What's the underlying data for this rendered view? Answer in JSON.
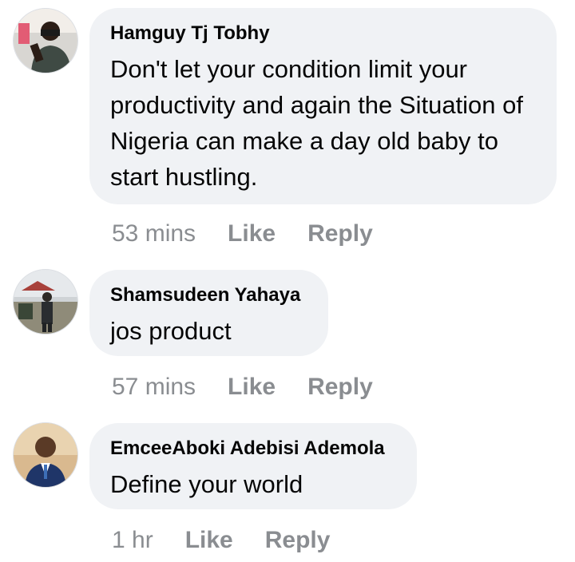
{
  "comments": [
    {
      "author": "Hamguy Tj Tobhy",
      "text": "Don't let your condition limit your productivity and again the Situation of Nigeria can make a day old baby to start hustling.",
      "time": "53 mins",
      "like_label": "Like",
      "reply_label": "Reply"
    },
    {
      "author": "Shamsudeen Yahaya",
      "text": "jos product",
      "time": "57 mins",
      "like_label": "Like",
      "reply_label": "Reply"
    },
    {
      "author": "EmceeAboki Adebisi Ademola",
      "text": "Define your world",
      "time": "1 hr",
      "like_label": "Like",
      "reply_label": "Reply"
    }
  ],
  "colors": {
    "bubble_bg": "#f0f2f5",
    "text": "#050505",
    "meta": "#8a8d91"
  }
}
